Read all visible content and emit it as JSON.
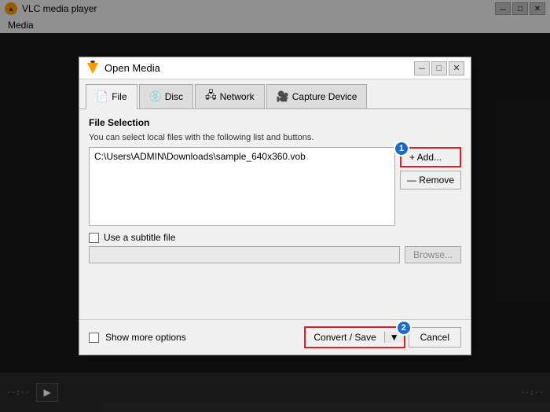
{
  "vlc": {
    "title": "VLC media player",
    "menu_items": [
      "Media"
    ],
    "time_left": "--:--",
    "time_right": "--:--"
  },
  "dialog": {
    "title": "Open Media",
    "tabs": [
      {
        "id": "file",
        "label": "File",
        "icon": "📄",
        "active": true
      },
      {
        "id": "disc",
        "label": "Disc",
        "icon": "💿",
        "active": false
      },
      {
        "id": "network",
        "label": "Network",
        "icon": "🖧",
        "active": false
      },
      {
        "id": "capture",
        "label": "Capture Device",
        "icon": "🎥",
        "active": false
      }
    ],
    "file_selection": {
      "section_title": "File Selection",
      "description": "You can select local files with the following list and buttons.",
      "files": [
        "C:\\Users\\ADMIN\\Downloads\\sample_640x360.vob"
      ],
      "add_button": "+ Add...",
      "remove_button": "— Remove",
      "add_badge": "1"
    },
    "subtitle": {
      "checkbox_label": "Use a subtitle file",
      "browse_button": "Browse..."
    },
    "footer": {
      "show_more_label": "Show more options",
      "convert_save_label": "Convert / Save",
      "convert_arrow": "▼",
      "cancel_label": "Cancel",
      "convert_badge": "2"
    }
  }
}
